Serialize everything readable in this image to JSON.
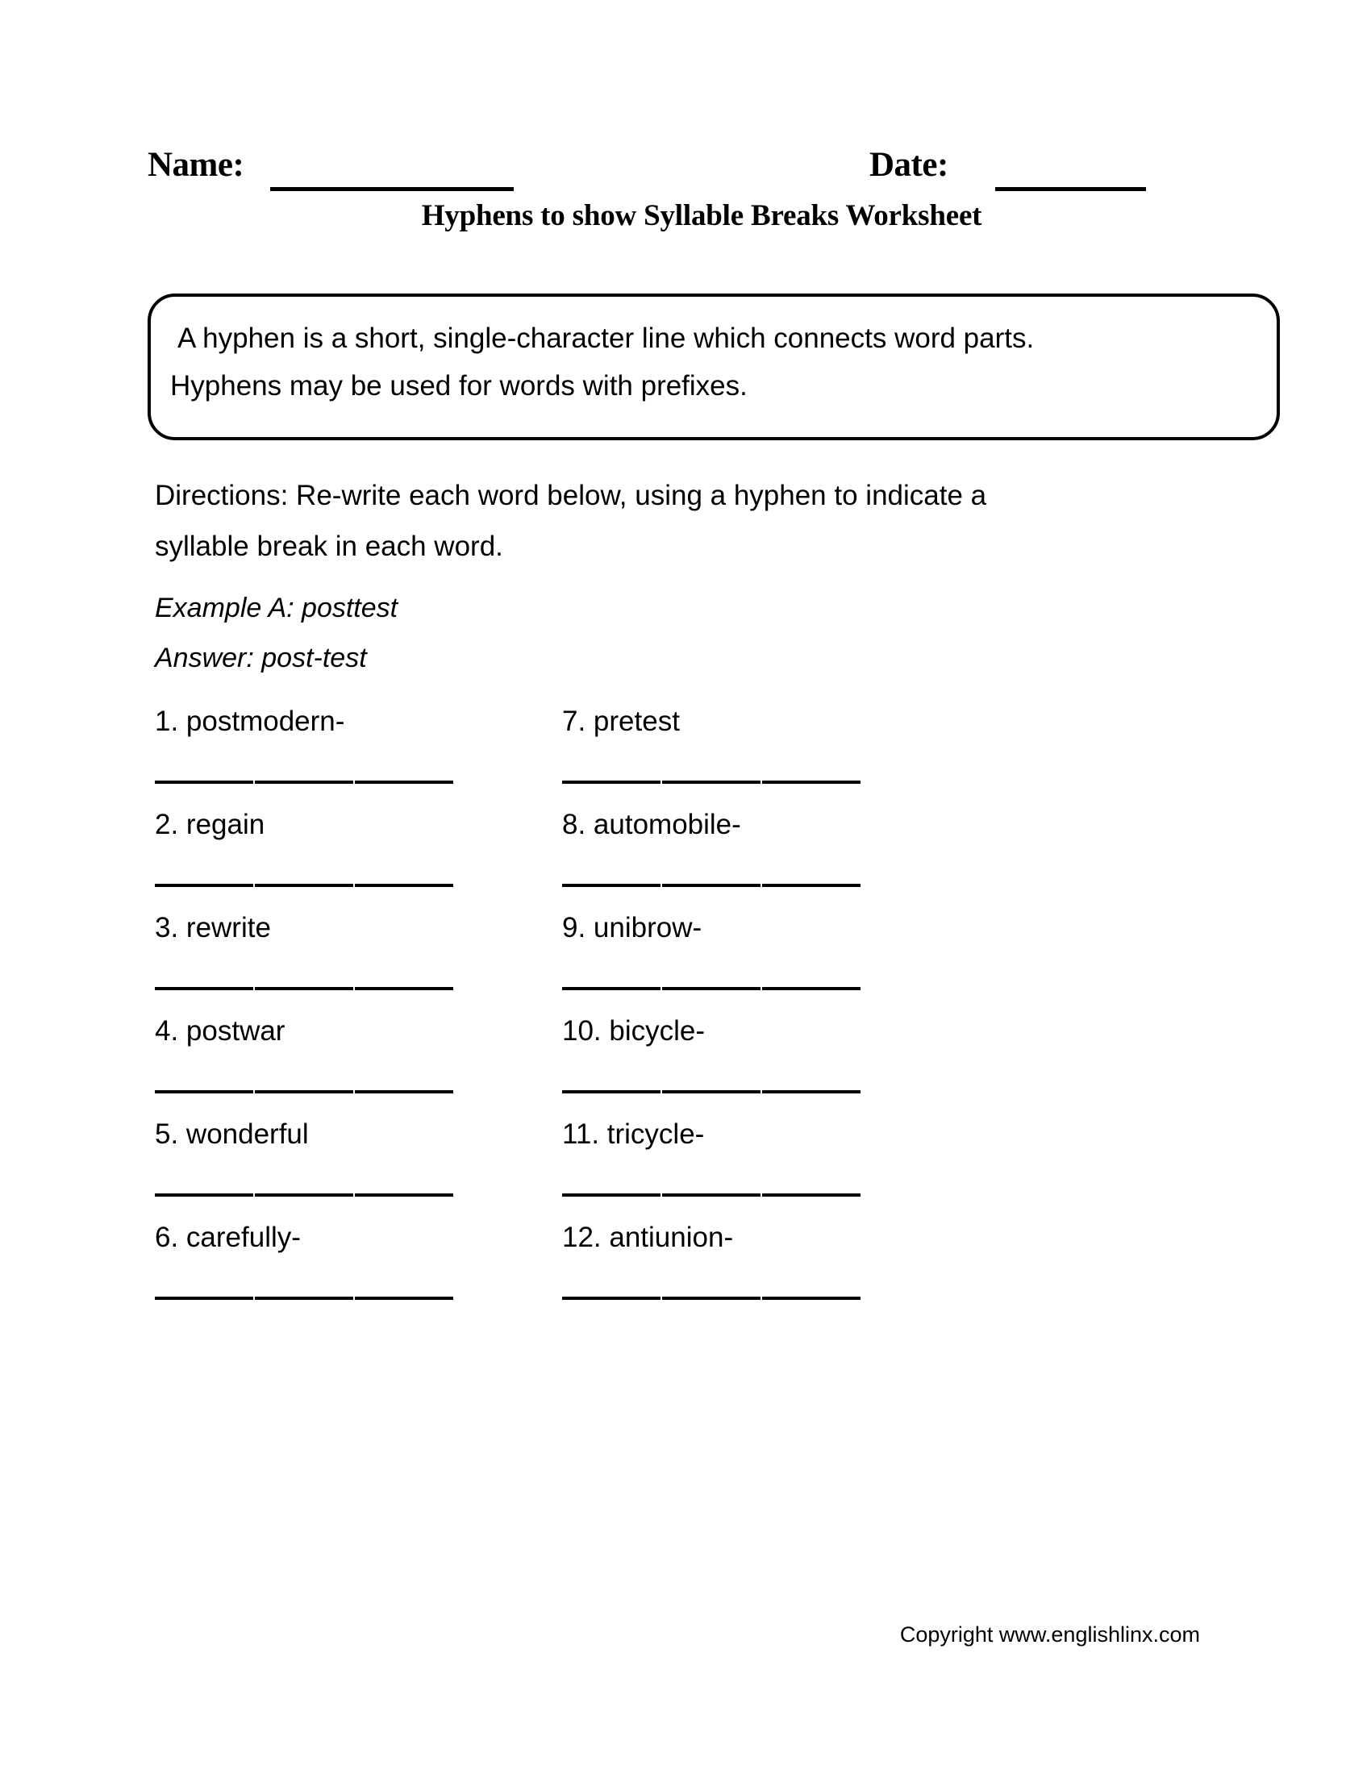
{
  "header": {
    "name_label": "Name:",
    "date_label": "Date:",
    "name_blank": "",
    "date_blank": ""
  },
  "title": "Hyphens to show Syllable Breaks Worksheet",
  "definition": {
    "line1": "A hyphen is a short, single-character line which connects word parts.",
    "line2": "Hyphens may be used for words with prefixes."
  },
  "directions": {
    "line1": "Directions: Re-write each word below, using a hyphen to indicate a",
    "line2": "syllable break in each word."
  },
  "example": {
    "prompt": "Example A: posttest",
    "answer": "Answer: post-test"
  },
  "questions": {
    "left": [
      {
        "number": "1.",
        "word": "postmodern-",
        "text": "1. postmodern-",
        "answer": ""
      },
      {
        "number": "2.",
        "word": "regain",
        "text": "2. regain",
        "answer": ""
      },
      {
        "number": "3.",
        "word": "rewrite",
        "text": "3. rewrite",
        "answer": ""
      },
      {
        "number": "4.",
        "word": "postwar",
        "text": "4. postwar",
        "answer": ""
      },
      {
        "number": "5.",
        "word": "wonderful",
        "text": "5. wonderful",
        "answer": ""
      },
      {
        "number": "6.",
        "word": "carefully-",
        "text": "6. carefully-",
        "answer": ""
      }
    ],
    "right": [
      {
        "number": "7.",
        "word": "pretest",
        "text": "7. pretest",
        "answer": ""
      },
      {
        "number": "8.",
        "word": "automobile-",
        "text": "8. automobile-",
        "answer": ""
      },
      {
        "number": "9.",
        "word": "unibrow-",
        "text": "9. unibrow-",
        "answer": ""
      },
      {
        "number": "10.",
        "word": "bicycle-",
        "text": "10. bicycle-",
        "answer": ""
      },
      {
        "number": "11.",
        "word": "tricycle-",
        "text": "11. tricycle-",
        "answer": ""
      },
      {
        "number": "12.",
        "word": "antiunion-",
        "text": "12. antiunion-",
        "answer": ""
      }
    ]
  },
  "footer": {
    "copyright": "Copyright www.englishlinx.com"
  },
  "colors": {
    "ink": "#000000",
    "paper": "#ffffff"
  }
}
